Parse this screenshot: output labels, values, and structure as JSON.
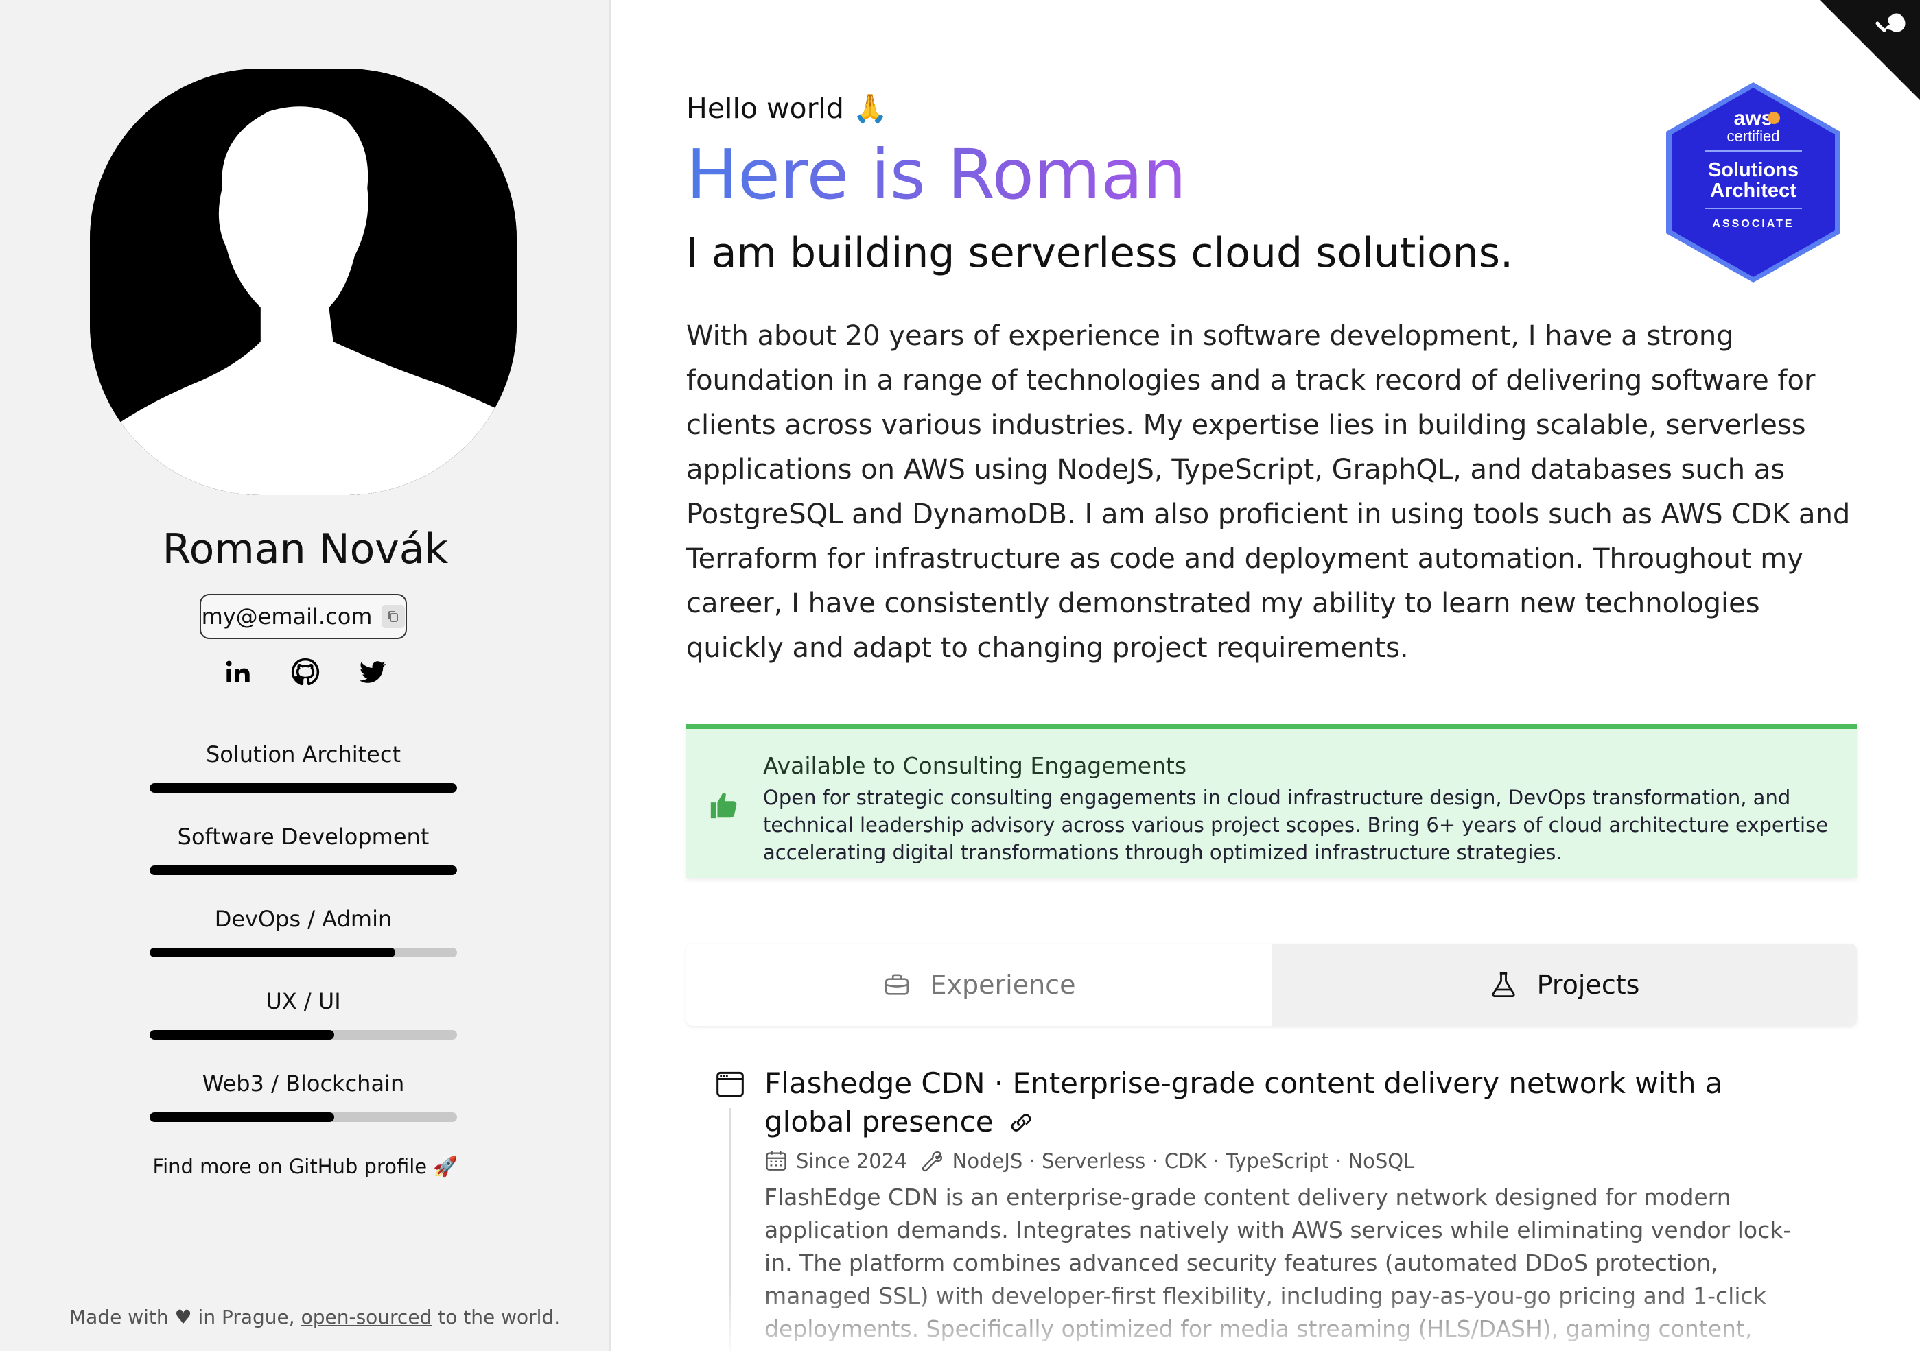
{
  "sidebar": {
    "name": "Roman Novák",
    "email": "my@email.com",
    "socials": [
      {
        "icon": "linkedin-icon",
        "label": "in"
      },
      {
        "icon": "github-icon"
      },
      {
        "icon": "twitter-icon"
      }
    ],
    "skills": [
      {
        "label": "Solution Architect",
        "level": 1.0
      },
      {
        "label": "Software Development",
        "level": 1.0
      },
      {
        "label": "DevOps / Admin",
        "level": 0.8
      },
      {
        "label": "UX / UI",
        "level": 0.6
      },
      {
        "label": "Web3 / Blockchain",
        "level": 0.6
      }
    ],
    "github_more": "Find more on GitHub profile 🚀",
    "footer": {
      "prefix": "Made with",
      "heart": "♥",
      "middle": "in Prague,",
      "link": "open-sourced",
      "suffix": "to the world."
    }
  },
  "main": {
    "hello": "Hello world 🙏",
    "headline": "Here is Roman",
    "tagline": "I am building serverless cloud solutions.",
    "intro": "With about 20 years of experience in software development, I have a strong foundation in a range of technologies and a track record of delivering software for clients across various industries. My expertise lies in building scalable, serverless applications on AWS using NodeJS, TypeScript, GraphQL, and databases such as PostgreSQL and DynamoDB. I am also proficient in using tools such as AWS CDK and Terraform for infrastructure as code and deployment automation. Throughout my career, I have consistently demonstrated my ability to learn new technologies quickly and adapt to changing project requirements.",
    "badge": {
      "brand": "aws",
      "certified": "certified",
      "title_line1": "Solutions",
      "title_line2": "Architect",
      "level": "ASSOCIATE"
    },
    "alert": {
      "title": "Available to Consulting Engagements",
      "text": "Open for strategic consulting engagements in cloud infrastructure design, DevOps transformation, and technical leadership advisory across various project scopes. Bring 6+ years of cloud architecture expertise accelerating digital transformations through optimized infrastructure strategies."
    },
    "tabs": [
      {
        "label": "Experience",
        "icon": "briefcase-icon",
        "active": false
      },
      {
        "label": "Projects",
        "icon": "flask-icon",
        "active": true
      }
    ],
    "project": {
      "title": "Flashedge CDN · Enterprise-grade content delivery network with a global presence",
      "since": "Since 2024",
      "tech": "NodeJS · Serverless · CDK · TypeScript · NoSQL",
      "description": "FlashEdge CDN is an enterprise-grade content delivery network designed for modern application demands. Integrates natively with AWS services while eliminating vendor lock-in. The platform combines advanced security features (automated DDoS protection, managed SSL) with developer-first flexibility, including pay-as-you-go pricing and 1-click deployments. Specifically optimized for media streaming (HLS/DASH), gaming content, and API-driven architectures, FlashEdge reduces"
    }
  },
  "colors": {
    "accent_start": "#4f7ae8",
    "accent_end": "#8a5ce0",
    "alert_bg": "#e1f8e6",
    "alert_border": "#4cbb5e",
    "badge_blue": "#2727d8"
  }
}
